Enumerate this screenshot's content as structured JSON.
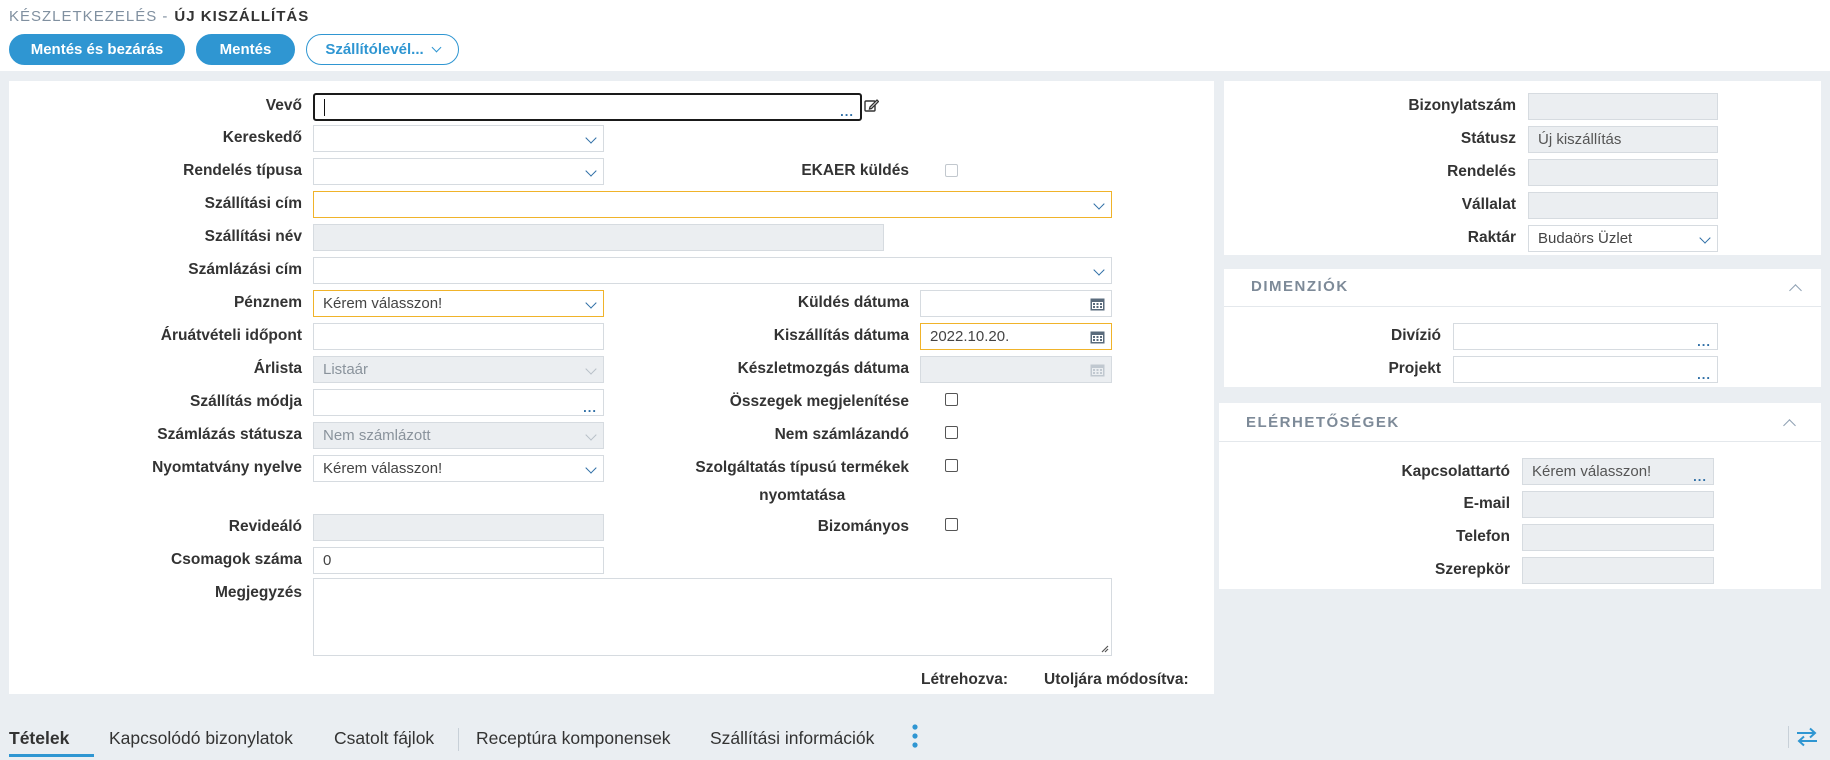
{
  "breadcrumb": {
    "parent": "KÉSZLETKEZELÉS -",
    "current": "ÚJ KISZÁLLÍTÁS"
  },
  "toolbar": {
    "save_close": "Mentés és bezárás",
    "save": "Mentés",
    "delivery_note": "Szállítólevél..."
  },
  "form": {
    "vevo": {
      "label": "Vevő",
      "value": ""
    },
    "kereskedo": {
      "label": "Kereskedő",
      "value": ""
    },
    "rendeles_tipusa": {
      "label": "Rendelés típusa",
      "value": ""
    },
    "ekaer": {
      "label": "EKAER küldés"
    },
    "szallitasi_cim": {
      "label": "Szállítási cím",
      "value": ""
    },
    "szallitasi_nev": {
      "label": "Szállítási név",
      "value": ""
    },
    "szamlazasi_cim": {
      "label": "Számlázási cím",
      "value": ""
    },
    "penznem": {
      "label": "Pénznem",
      "value": "Kérem válasszon!"
    },
    "kuldes_datuma": {
      "label": "Küldés dátuma",
      "value": ""
    },
    "aruatveteli_idopont": {
      "label": "Áruátvételi időpont",
      "value": ""
    },
    "kiszallitas_datuma": {
      "label": "Kiszállítás dátuma",
      "value": "2022.10.20."
    },
    "arlista": {
      "label": "Árlista",
      "value": "Listaár"
    },
    "keszletmozgas_datuma": {
      "label": "Készletmozgás dátuma",
      "value": ""
    },
    "szallitas_modja": {
      "label": "Szállítás módja",
      "value": ""
    },
    "osszegek_megjelenitese": {
      "label": "Összegek megjelenítése"
    },
    "szamlazas_statusza": {
      "label": "Számlázás státusza",
      "value": "Nem számlázott"
    },
    "nem_szamlazando": {
      "label": "Nem számlázandó"
    },
    "nyomtatvany_nyelve": {
      "label": "Nyomtatvány nyelve",
      "value": "Kérem válasszon!"
    },
    "szolgaltatas_nyomtatasa": {
      "label_line1": "Szolgáltatás típusú termékek",
      "label_line2": "nyomtatása"
    },
    "revidealo": {
      "label": "Revideáló",
      "value": ""
    },
    "bizomanyos": {
      "label": "Bizományos"
    },
    "csomagok_szama": {
      "label": "Csomagok száma",
      "value": "0"
    },
    "megjegyzes": {
      "label": "Megjegyzés",
      "value": ""
    },
    "letrehozva": "Létrehozva:",
    "utoljara_modositva": "Utoljára módosítva:"
  },
  "doc": {
    "bizonylatszam": {
      "label": "Bizonylatszám",
      "value": ""
    },
    "statusz": {
      "label": "Státusz",
      "value": "Új kiszállítás"
    },
    "rendeles": {
      "label": "Rendelés",
      "value": ""
    },
    "vallalat": {
      "label": "Vállalat",
      "value": ""
    },
    "raktar": {
      "label": "Raktár",
      "value": "Budaörs Üzlet"
    }
  },
  "dimensions": {
    "title": "DIMENZIÓK",
    "divizio": {
      "label": "Divízió",
      "value": ""
    },
    "projekt": {
      "label": "Projekt",
      "value": ""
    }
  },
  "contacts": {
    "title": "ELÉRHETŐSÉGEK",
    "kapcsolattarto": {
      "label": "Kapcsolattartó",
      "value": "Kérem válasszon!"
    },
    "email": {
      "label": "E-mail",
      "value": ""
    },
    "telefon": {
      "label": "Telefon",
      "value": ""
    },
    "szerepkor": {
      "label": "Szerepkör",
      "value": ""
    }
  },
  "tabs": [
    "Tételek",
    "Kapcsolódó bizonylatok",
    "Csatolt fájlok",
    "Receptúra komponensek",
    "Szállítási információk"
  ],
  "colors": {
    "accent": "#2f96d2",
    "warning_border": "#f0b32a",
    "background": "#eaeef2"
  },
  "icons": {
    "more": "vertical-dots-icon",
    "swap": "swap-arrows-icon",
    "edit": "edit-icon",
    "calendar": "calendar-icon"
  }
}
